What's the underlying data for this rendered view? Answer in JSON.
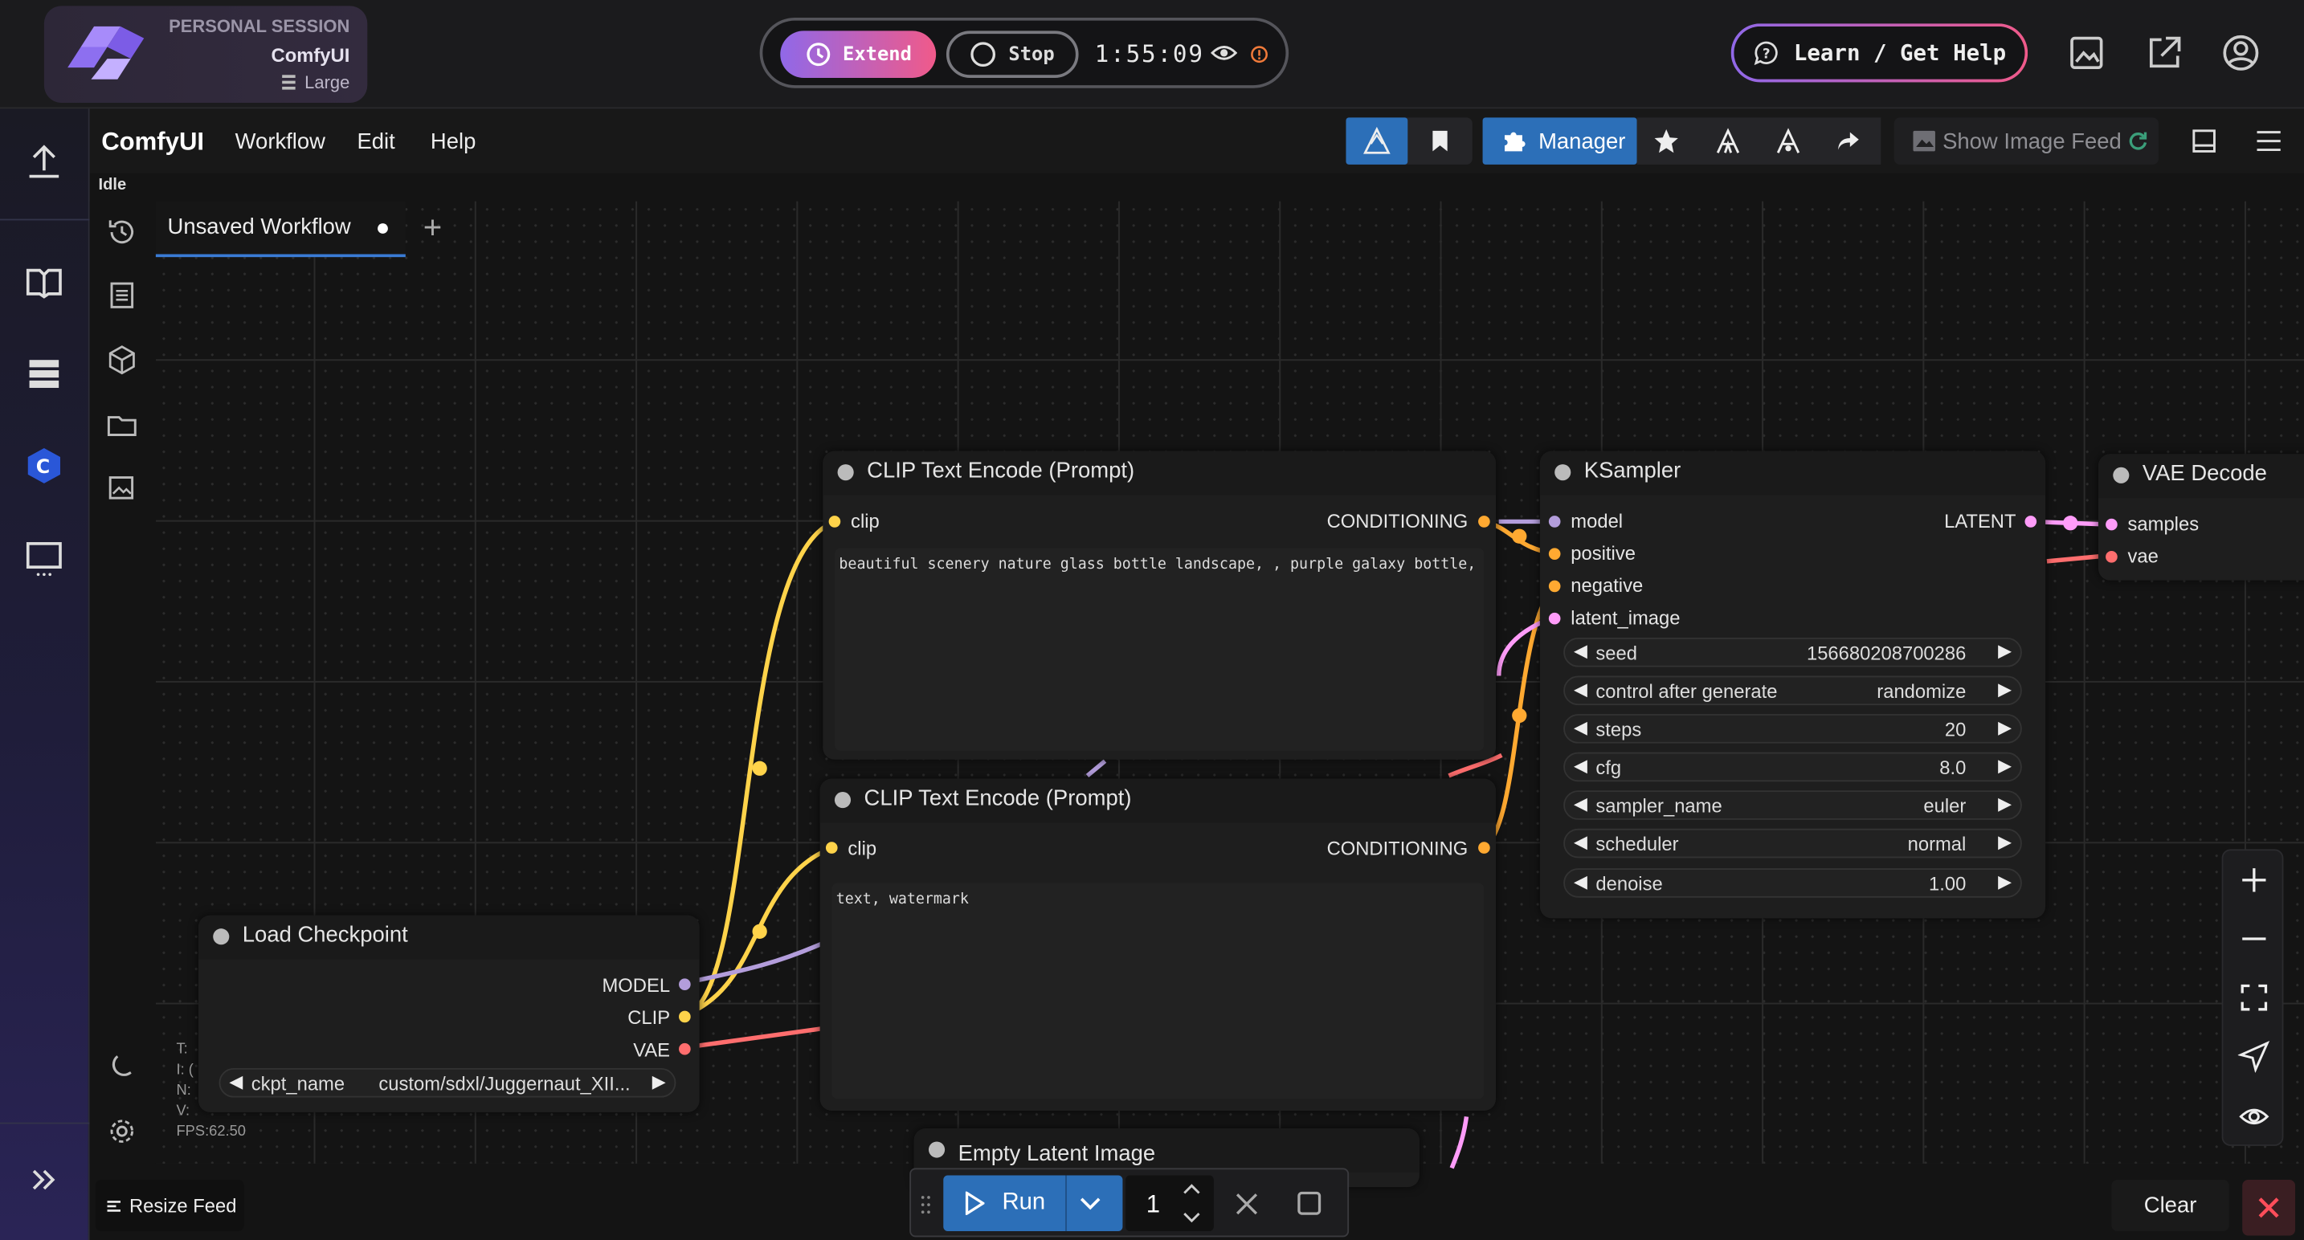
{
  "session": {
    "label": "PERSONAL SESSION",
    "app": "ComfyUI",
    "size": "Large"
  },
  "controls": {
    "extend": "Extend",
    "stop": "Stop",
    "timer": "1:55:09"
  },
  "help": {
    "label": "Learn / Get Help"
  },
  "menubar": {
    "brand": "ComfyUI",
    "items": [
      "Workflow",
      "Edit",
      "Help"
    ],
    "status": "Idle",
    "manager": "Manager",
    "image_feed": "Show Image Feed"
  },
  "tab": {
    "name": "Unsaved Workflow"
  },
  "nodes": {
    "clip_pos": {
      "title": "CLIP Text Encode (Prompt)",
      "input": "clip",
      "output": "CONDITIONING",
      "text": "beautiful scenery nature glass bottle landscape, , purple galaxy bottle,"
    },
    "clip_neg": {
      "title": "CLIP Text Encode (Prompt)",
      "input": "clip",
      "output": "CONDITIONING",
      "text": "text, watermark"
    },
    "ksampler": {
      "title": "KSampler",
      "inputs": [
        "model",
        "positive",
        "negative",
        "latent_image"
      ],
      "output": "LATENT",
      "widgets": [
        {
          "label": "seed",
          "value": "156680208700286"
        },
        {
          "label": "control after generate",
          "value": "randomize"
        },
        {
          "label": "steps",
          "value": "20"
        },
        {
          "label": "cfg",
          "value": "8.0"
        },
        {
          "label": "sampler_name",
          "value": "euler"
        },
        {
          "label": "scheduler",
          "value": "normal"
        },
        {
          "label": "denoise",
          "value": "1.00"
        }
      ]
    },
    "vae_decode": {
      "title": "VAE Decode",
      "inputs": [
        "samples",
        "vae"
      ]
    },
    "load_ckpt": {
      "title": "Load Checkpoint",
      "outputs": [
        "MODEL",
        "CLIP",
        "VAE"
      ],
      "widget_label": "ckpt_name",
      "widget_value": "custom/sdxl/Juggernaut_XII..."
    },
    "empty_latent": {
      "title": "Empty Latent Image"
    }
  },
  "stats": {
    "t": "T:",
    "i": "I: (",
    "n": "N:",
    "v": "V:",
    "fps": "FPS:62.50"
  },
  "bottom": {
    "resize": "Resize Feed",
    "run": "Run",
    "count": "1",
    "clear": "Clear"
  },
  "colors": {
    "accent": "#2c6fb8",
    "clip": "#ffd34a",
    "model": "#b39ddb",
    "vae": "#ff6e6e",
    "latent": "#ff9cf9",
    "conditioning": "#ffa931"
  }
}
